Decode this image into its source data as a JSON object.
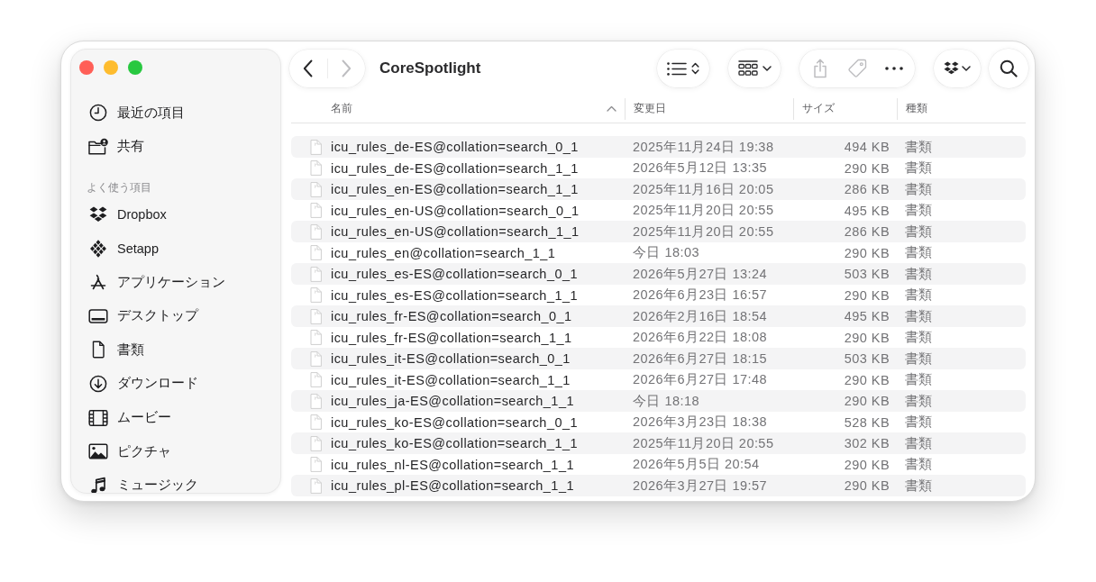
{
  "sidebar": {
    "items": [
      {
        "label": "最近の項目",
        "selected": false
      },
      {
        "label": "共有",
        "selected": false
      }
    ],
    "sections": [
      {
        "title": "よく使う項目",
        "items": [
          {
            "label": "Dropbox",
            "selected": false
          },
          {
            "label": "Setapp",
            "selected": false
          },
          {
            "label": "アプリケーション",
            "selected": false
          },
          {
            "label": "デスクトップ",
            "selected": false
          },
          {
            "label": "書類",
            "selected": false
          },
          {
            "label": "ダウンロード",
            "selected": false
          },
          {
            "label": "ムービー",
            "selected": false
          },
          {
            "label": "ピクチャ",
            "selected": false
          },
          {
            "label": "ミュージック",
            "selected": false
          }
        ]
      }
    ]
  },
  "toolbar": {
    "back": {
      "disabled": false
    },
    "forward": {
      "disabled": true
    },
    "title": "CoreSpotlight",
    "share": {
      "disabled": true
    },
    "tag": {
      "disabled": true
    }
  },
  "table": {
    "columns": [
      {
        "label": "名前",
        "sorted": true
      },
      {
        "label": "変更日",
        "sorted": false
      },
      {
        "label": "サイズ",
        "sorted": false
      },
      {
        "label": "種類",
        "sorted": false
      }
    ],
    "rows": [
      {
        "name": "icu_rules_de-ES@collation=search_0_1",
        "date_modified": "2025年11月24日 19:38",
        "size": "494 KB",
        "file_kind": "書類",
        "selected": false
      },
      {
        "name": "icu_rules_de-ES@collation=search_1_1",
        "date_modified": "2026年5月12日 13:35",
        "size": "290 KB",
        "file_kind": "書類",
        "selected": false
      },
      {
        "name": "icu_rules_en-ES@collation=search_1_1",
        "date_modified": "2025年11月16日 20:05",
        "size": "286 KB",
        "file_kind": "書類",
        "selected": false
      },
      {
        "name": "icu_rules_en-US@collation=search_0_1",
        "date_modified": "2025年11月20日 20:55",
        "size": "495 KB",
        "file_kind": "書類",
        "selected": false
      },
      {
        "name": "icu_rules_en-US@collation=search_1_1",
        "date_modified": "2025年11月20日 20:55",
        "size": "286 KB",
        "file_kind": "書類",
        "selected": false
      },
      {
        "name": "icu_rules_en@collation=search_1_1",
        "date_modified": "今日 18:03",
        "size": "290 KB",
        "file_kind": "書類",
        "selected": false
      },
      {
        "name": "icu_rules_es-ES@collation=search_0_1",
        "date_modified": "2026年5月27日 13:24",
        "size": "503 KB",
        "file_kind": "書類",
        "selected": false
      },
      {
        "name": "icu_rules_es-ES@collation=search_1_1",
        "date_modified": "2026年6月23日 16:57",
        "size": "290 KB",
        "file_kind": "書類",
        "selected": false
      },
      {
        "name": "icu_rules_fr-ES@collation=search_0_1",
        "date_modified": "2026年2月16日 18:54",
        "size": "495 KB",
        "file_kind": "書類",
        "selected": false
      },
      {
        "name": "icu_rules_fr-ES@collation=search_1_1",
        "date_modified": "2026年6月22日 18:08",
        "size": "290 KB",
        "file_kind": "書類",
        "selected": false
      },
      {
        "name": "icu_rules_it-ES@collation=search_0_1",
        "date_modified": "2026年6月27日 18:15",
        "size": "503 KB",
        "file_kind": "書類",
        "selected": false
      },
      {
        "name": "icu_rules_it-ES@collation=search_1_1",
        "date_modified": "2026年6月27日 17:48",
        "size": "290 KB",
        "file_kind": "書類",
        "selected": false
      },
      {
        "name": "icu_rules_ja-ES@collation=search_1_1",
        "date_modified": "今日 18:18",
        "size": "290 KB",
        "file_kind": "書類",
        "selected": false
      },
      {
        "name": "icu_rules_ko-ES@collation=search_0_1",
        "date_modified": "2026年3月23日 18:38",
        "size": "528 KB",
        "file_kind": "書類",
        "selected": false
      },
      {
        "name": "icu_rules_ko-ES@collation=search_1_1",
        "date_modified": "2025年11月20日 20:55",
        "size": "302 KB",
        "file_kind": "書類",
        "selected": false
      },
      {
        "name": "icu_rules_nl-ES@collation=search_1_1",
        "date_modified": "2026年5月5日 20:54",
        "size": "290 KB",
        "file_kind": "書類",
        "selected": false
      },
      {
        "name": "icu_rules_pl-ES@collation=search_1_1",
        "date_modified": "2026年3月27日 19:57",
        "size": "290 KB",
        "file_kind": "書類",
        "selected": false
      }
    ]
  }
}
